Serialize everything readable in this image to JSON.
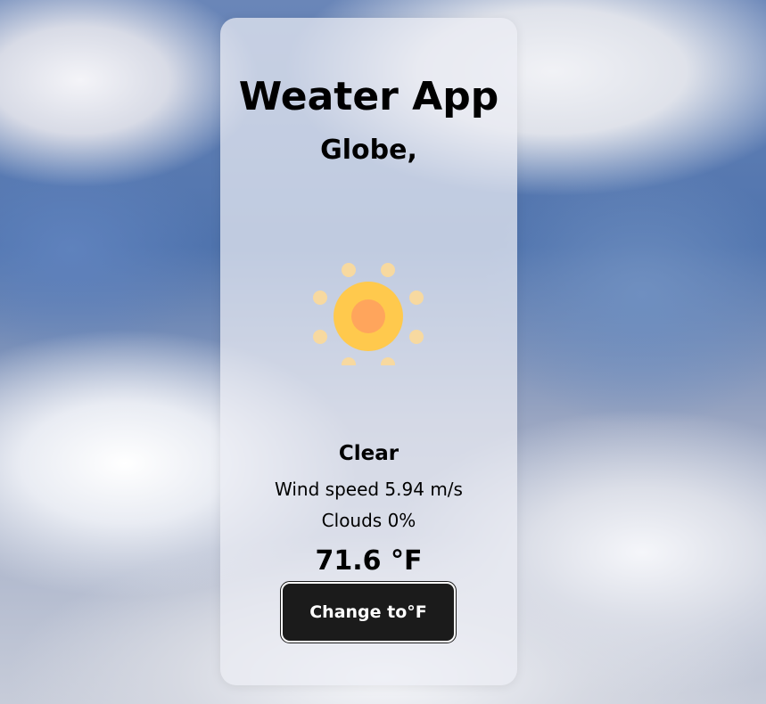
{
  "app": {
    "title": "Weater App",
    "city": "Globe,"
  },
  "weather": {
    "icon": "sun-icon",
    "condition": "Clear",
    "wind": "Wind speed 5.94 m/s",
    "clouds": "Clouds 0%",
    "temperature": "71.6 °F"
  },
  "actions": {
    "change_unit_label": "Change to°F"
  },
  "colors": {
    "card_bg": "rgba(235,237,244,0.72)",
    "sun_outer": "#ffc94d",
    "sun_inner": "#ffa55c",
    "button_bg": "#1b1b1b",
    "button_text": "#ffffff"
  }
}
